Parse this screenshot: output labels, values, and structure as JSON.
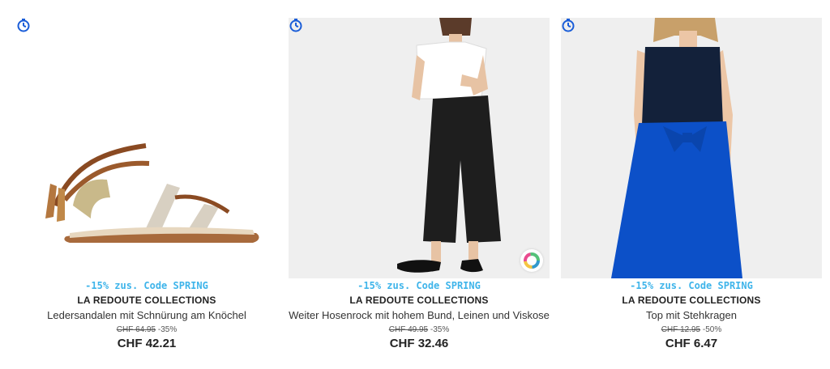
{
  "products": [
    {
      "promo": "-15% zus. Code SPRING",
      "brand": "LA REDOUTE COLLECTIONS",
      "name": "Ledersandalen mit Schnürung am Knöchel",
      "old_price": "CHF 64.95",
      "discount": "-35%",
      "price": "CHF 42.21",
      "image": "sandal",
      "badge_icon": "timer-icon"
    },
    {
      "promo": "-15% zus. Code SPRING",
      "brand": "LA REDOUTE COLLECTIONS",
      "name": "Weiter Hosenrock mit hohem Bund, Leinen und Viskose",
      "old_price": "CHF 49.95",
      "discount": "-35%",
      "price": "CHF 32.46",
      "image": "culottes-model",
      "badge_icon": "timer-icon",
      "extra_icon": "color-swatch-icon"
    },
    {
      "promo": "-15% zus. Code SPRING",
      "brand": "LA REDOUTE COLLECTIONS",
      "name": "Top mit Stehkragen",
      "old_price": "CHF 12.95",
      "discount": "-50%",
      "price": "CHF 6.47",
      "image": "top-model",
      "badge_icon": "timer-icon"
    }
  ],
  "colors": {
    "promo": "#3eb4ea",
    "timer": "#1a5dd8"
  }
}
